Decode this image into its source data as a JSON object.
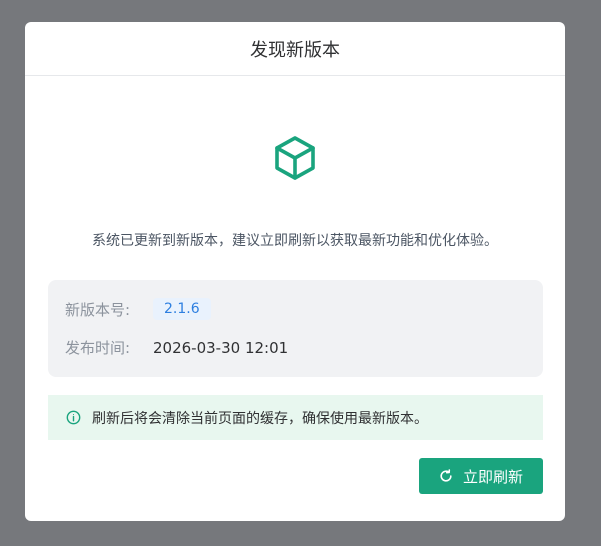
{
  "dialog": {
    "title": "发现新版本",
    "icon": "package-icon",
    "message": "系统已更新到新版本，建议立即刷新以获取最新功能和优化体验。",
    "version_label": "新版本号:",
    "version_value": "2.1.6",
    "release_label": "发布时间:",
    "release_value": "2026-03-30 12:01",
    "alert_icon": "info-circle-icon",
    "alert_text": "刷新后将会清除当前页面的缓存，确保使用最新版本。",
    "refresh_icon": "refresh-icon",
    "refresh_label": "立即刷新"
  },
  "colors": {
    "primary": "#1aa47e",
    "overlay": "#76787c",
    "version_tag_bg": "#e9f2fd",
    "version_tag_text": "#2d7fe0",
    "alert_bg": "#e8f7ef"
  }
}
